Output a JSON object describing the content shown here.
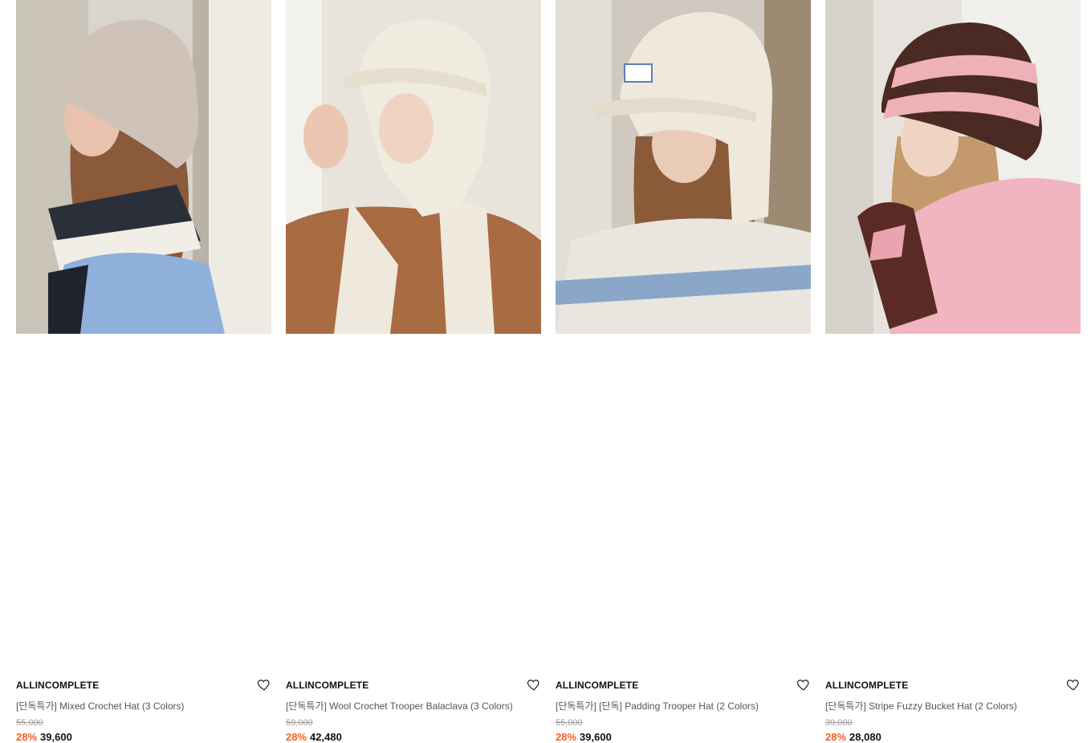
{
  "products": [
    {
      "brand": "ALLINCOMPLETE",
      "name": "[단독특가] Mixed Crochet Hat (3 Colors)",
      "original_price": "55,000",
      "discount": "28%",
      "price": "39,600",
      "wishlist_icon": "heart-outline-icon",
      "image_icon": "model-photo-crochet-hat"
    },
    {
      "brand": "ALLINCOMPLETE",
      "name": "[단독특가] Wool Crochet Trooper Balaclava (3 Colors)",
      "original_price": "59,000",
      "discount": "28%",
      "price": "42,480",
      "wishlist_icon": "heart-outline-icon",
      "image_icon": "model-photo-balaclava"
    },
    {
      "brand": "ALLINCOMPLETE",
      "name": "[단독특가] [단독] Padding Trooper Hat (2 Colors)",
      "original_price": "55,000",
      "discount": "28%",
      "price": "39,600",
      "wishlist_icon": "heart-outline-icon",
      "image_icon": "model-photo-trooper-hat"
    },
    {
      "brand": "ALLINCOMPLETE",
      "name": "[단독특가] Stripe Fuzzy Bucket Hat (2 Colors)",
      "original_price": "39,000",
      "discount": "28%",
      "price": "28,080",
      "wishlist_icon": "heart-outline-icon",
      "image_icon": "model-photo-bucket-hat"
    }
  ],
  "colors": {
    "discount": "#ff5a1f",
    "price": "#111111",
    "original_price": "#9a9a9a",
    "name": "#555555"
  }
}
